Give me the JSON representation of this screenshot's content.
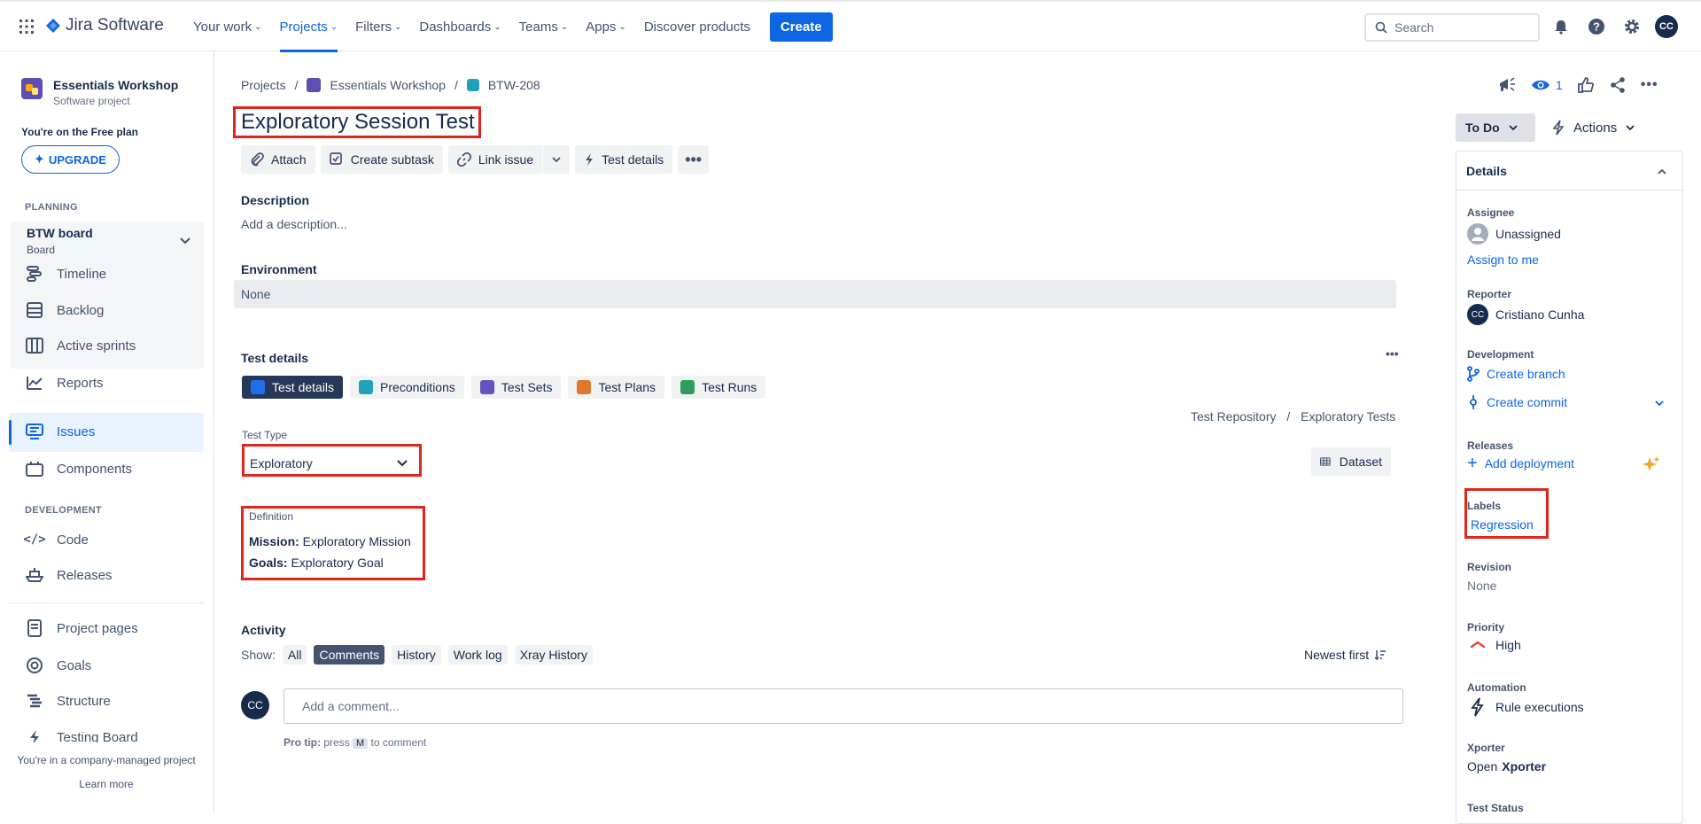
{
  "topnav": {
    "logo_text": "Jira Software",
    "items": [
      {
        "label": "Your work",
        "dropdown": true,
        "active": false
      },
      {
        "label": "Projects",
        "dropdown": true,
        "active": true
      },
      {
        "label": "Filters",
        "dropdown": true,
        "active": false
      },
      {
        "label": "Dashboards",
        "dropdown": true,
        "active": false
      },
      {
        "label": "Teams",
        "dropdown": true,
        "active": false
      },
      {
        "label": "Apps",
        "dropdown": true,
        "active": false
      },
      {
        "label": "Discover products",
        "dropdown": false,
        "active": false
      }
    ],
    "create_label": "Create",
    "search_placeholder": "Search",
    "avatar_initials": "CC",
    "accent": "#0c66e4"
  },
  "sidebar": {
    "project_name": "Essentials Workshop",
    "project_type": "Software project",
    "plan_note": "You're on the Free plan",
    "upgrade_label": "UPGRADE",
    "planning_heading": "PLANNING",
    "board_name": "BTW board",
    "board_sub": "Board",
    "planning_items": [
      "Timeline",
      "Backlog",
      "Active sprints",
      "Reports"
    ],
    "issues_label": "Issues",
    "components_label": "Components",
    "development_heading": "DEVELOPMENT",
    "dev_items": [
      "Code",
      "Releases"
    ],
    "other_items": [
      "Project pages",
      "Goals",
      "Structure",
      "Testing Board"
    ],
    "footer_note": "You're in a company-managed project",
    "learn_more": "Learn more"
  },
  "main": {
    "breadcrumb": [
      "Projects",
      "Essentials Workshop",
      "BTW-208"
    ],
    "title": "Exploratory Session Test",
    "actions": [
      "Attach",
      "Create subtask",
      "Link issue",
      "Test details"
    ],
    "description_label": "Description",
    "description_placeholder": "Add a description...",
    "environment_label": "Environment",
    "environment_value": "None",
    "test_details_label": "Test details",
    "test_tabs": [
      {
        "label": "Test details",
        "color": "#1f6feb"
      },
      {
        "label": "Preconditions",
        "color": "#22a2b8"
      },
      {
        "label": "Test Sets",
        "color": "#6554c0"
      },
      {
        "label": "Test Plans",
        "color": "#e2772b"
      },
      {
        "label": "Test Runs",
        "color": "#2f9e5b"
      }
    ],
    "repo_path": "Test Repository",
    "repo_folder": "Exploratory Tests",
    "test_type_label": "Test Type",
    "test_type_value": "Exploratory",
    "dataset_label": "Dataset",
    "definition_label": "Definition",
    "mission_label": "Mission:",
    "mission_value": "Exploratory Mission",
    "goals_label": "Goals:",
    "goals_value": "Exploratory Goal",
    "activity_label": "Activity",
    "show_label": "Show:",
    "activity_filters": [
      {
        "label": "All",
        "selected": false
      },
      {
        "label": "Comments",
        "selected": true
      },
      {
        "label": "History",
        "selected": false
      },
      {
        "label": "Work log",
        "selected": false
      },
      {
        "label": "Xray History",
        "selected": false
      }
    ],
    "sort_label": "Newest first",
    "comment_avatar": "CC",
    "comment_placeholder": "Add a comment...",
    "protip_prefix": "Pro tip:",
    "protip_press": "press",
    "protip_key": "M",
    "protip_suffix": "to comment"
  },
  "right": {
    "watchers": "1",
    "status": "To Do",
    "actions_label": "Actions",
    "details_label": "Details",
    "assignee_label": "Assignee",
    "assignee_value": "Unassigned",
    "assign_me": "Assign to me",
    "reporter_label": "Reporter",
    "reporter_initials": "CC",
    "reporter_value": "Cristiano Cunha",
    "development_label": "Development",
    "create_branch": "Create branch",
    "create_commit": "Create commit",
    "releases_label": "Releases",
    "add_deployment": "Add deployment",
    "labels_label": "Labels",
    "labels_value": "Regression",
    "revision_label": "Revision",
    "revision_value": "None",
    "priority_label": "Priority",
    "priority_value": "High",
    "automation_label": "Automation",
    "automation_value": "Rule executions",
    "xporter_label": "Xporter",
    "xporter_open": "Open",
    "xporter_name": "Xporter",
    "test_status_label": "Test Status"
  }
}
